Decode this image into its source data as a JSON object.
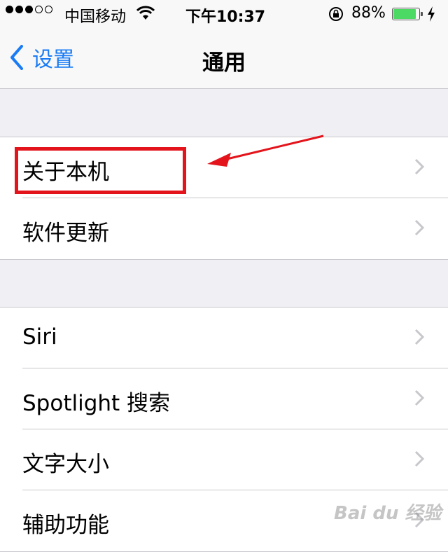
{
  "status_bar": {
    "carrier": "中国移动",
    "time": "下午10:37",
    "battery_percent": "88%",
    "signal_dots": [
      true,
      true,
      true,
      false,
      false
    ],
    "battery_level": 0.88
  },
  "nav": {
    "back_label": "设置",
    "title": "通用"
  },
  "groups": [
    {
      "items": [
        {
          "label": "关于本机"
        },
        {
          "label": "软件更新"
        }
      ]
    },
    {
      "items": [
        {
          "label": "Siri"
        },
        {
          "label": "Spotlight 搜索"
        },
        {
          "label": "文字大小"
        },
        {
          "label": "辅助功能"
        }
      ]
    }
  ],
  "watermark": "Bai du 经验",
  "colors": {
    "accent": "#1a7cf5",
    "annotation_red": "#e3141b",
    "battery_green": "#4cd964"
  }
}
